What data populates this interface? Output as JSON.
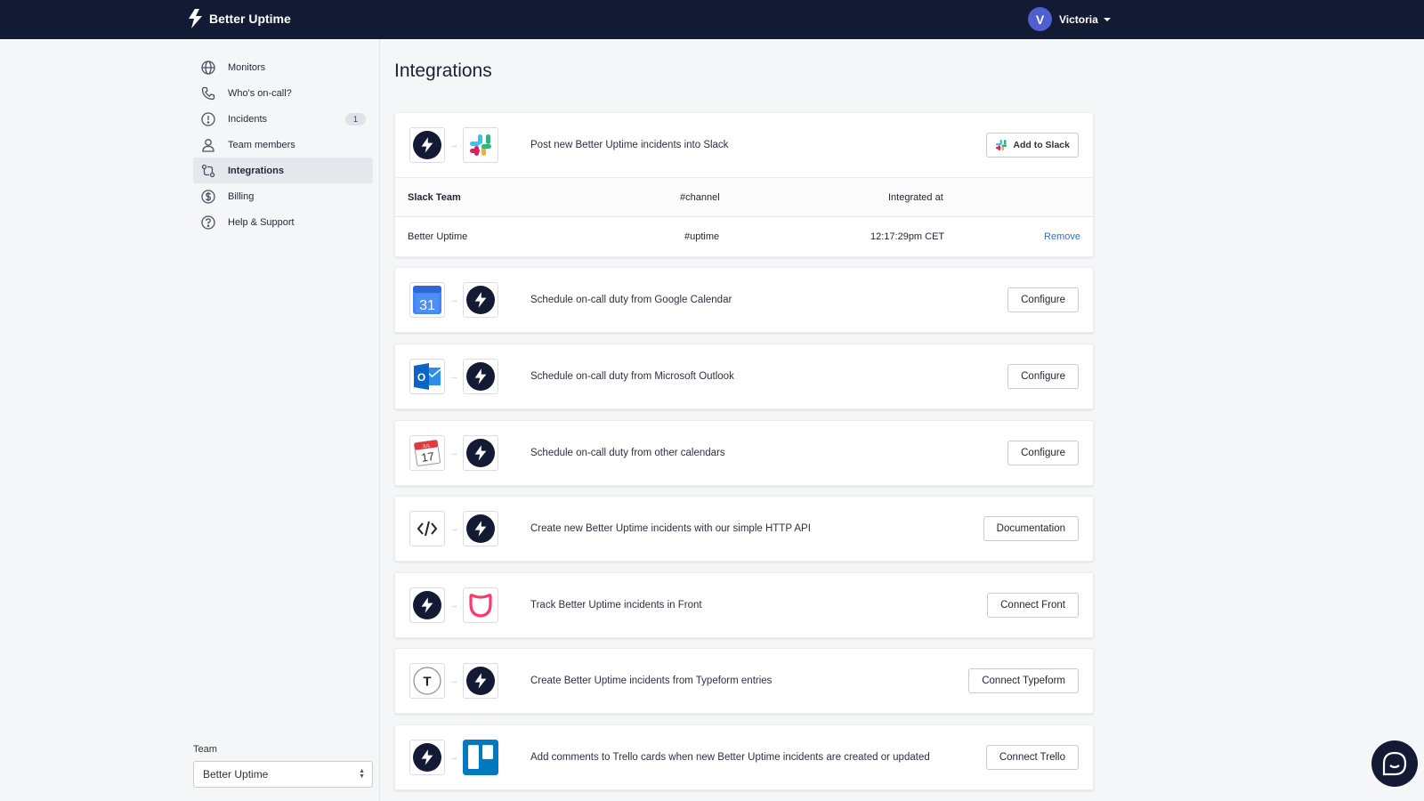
{
  "header": {
    "brand": "Better Uptime",
    "user_initial": "V",
    "user_name": "Victoria"
  },
  "sidebar": {
    "items": [
      {
        "label": "Monitors",
        "icon": "globe-icon"
      },
      {
        "label": "Who's on-call?",
        "icon": "phone-icon"
      },
      {
        "label": "Incidents",
        "icon": "alert-circle-icon",
        "badge": "1"
      },
      {
        "label": "Team members",
        "icon": "user-icon"
      },
      {
        "label": "Integrations",
        "icon": "integrations-icon",
        "active": true
      },
      {
        "label": "Billing",
        "icon": "dollar-icon"
      },
      {
        "label": "Help & Support",
        "icon": "help-icon"
      }
    ],
    "team_label": "Team",
    "team_value": "Better Uptime"
  },
  "main": {
    "title": "Integrations",
    "slack": {
      "description": "Post new Better Uptime incidents into Slack",
      "button": "Add to Slack",
      "table": {
        "headers": [
          "Slack Team",
          "#channel",
          "Integrated at"
        ],
        "row": {
          "team": "Better Uptime",
          "channel": "#uptime",
          "integrated_at": "12:17:29pm CET",
          "action": "Remove"
        }
      }
    },
    "integrations": [
      {
        "from": "google-calendar-icon",
        "to": "better-uptime-icon",
        "description": "Schedule on-call duty from Google Calendar",
        "button": "Configure",
        "calendar_day": "31"
      },
      {
        "from": "outlook-icon",
        "to": "better-uptime-icon",
        "description": "Schedule on-call duty from Microsoft Outlook",
        "button": "Configure",
        "outlook_letter": "O"
      },
      {
        "from": "calendar-icon",
        "to": "better-uptime-icon",
        "description": "Schedule on-call duty from other calendars",
        "button": "Configure",
        "calendar_day": "17",
        "calendar_month": "JUL"
      },
      {
        "from": "code-icon",
        "to": "better-uptime-icon",
        "description": "Create new Better Uptime incidents with our simple HTTP API",
        "button": "Documentation"
      },
      {
        "from": "better-uptime-icon",
        "to": "front-icon",
        "description": "Track Better Uptime incidents in Front",
        "button": "Connect Front"
      },
      {
        "from": "typeform-icon",
        "to": "better-uptime-icon",
        "description": "Create Better Uptime incidents from Typeform entries",
        "button": "Connect Typeform",
        "typeform_letter": "T"
      },
      {
        "from": "better-uptime-icon",
        "to": "trello-icon",
        "description": "Add comments to Trello cards when new Better Uptime incidents are created or updated",
        "button": "Connect Trello"
      }
    ]
  },
  "colors": {
    "topbar": "#131a33",
    "avatar": "#4f5fd1",
    "link": "#2d6fd4",
    "front": "#ff3a6a",
    "trello": "#0079bf",
    "google_blue": "#4285f4",
    "outlook_blue": "#0a64c8"
  }
}
